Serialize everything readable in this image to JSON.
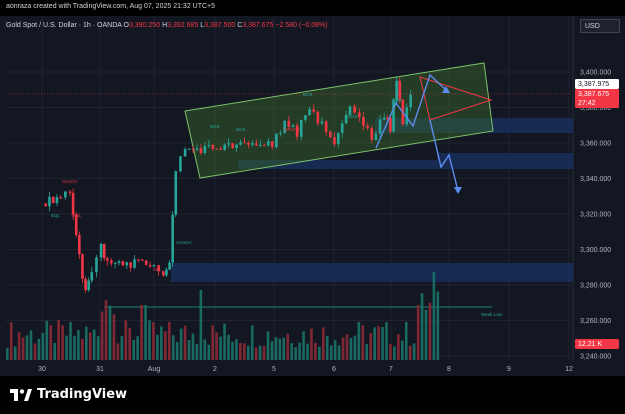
{
  "header": {
    "attribution": "aonraza created with TradingView.com, Aug 07, 2025 21:32 UTC+5"
  },
  "legend": {
    "symbol": "Gold Spot / U.S. Dollar · 1h · OANDA",
    "o_label": "O",
    "o_value": "3,390.250",
    "h_label": "H",
    "h_value": "3,392.685",
    "l_label": "L",
    "l_value": "3,387.500",
    "c_label": "C",
    "c_value": "3,387.675",
    "change": "−2.580 (−0.08%)"
  },
  "currency_button": "USD",
  "footer": {
    "brand": "TradingView",
    "logo_icon": "tradingview-logo-icon"
  },
  "colors": {
    "background": "#131722",
    "up": "#26a69a",
    "down": "#f23645",
    "channel": "#4caf50",
    "zone": "#1e3a6e",
    "arrow": "#2962ff",
    "triangle": "#f23645"
  },
  "chart_data": {
    "type": "candlestick",
    "symbol": "XAUUSD",
    "timeframe": "1h",
    "x_tick_labels": [
      "30",
      "31",
      "Aug",
      "2",
      "5",
      "6",
      "7",
      "8",
      "9",
      "12"
    ],
    "y_tick_labels": [
      "3,400.000",
      "3,380.000",
      "3,360.000",
      "3,340.000",
      "3,320.000",
      "3,300.000",
      "3,280.000",
      "3,260.000",
      "3,240.000"
    ],
    "ylim": [
      3240,
      3410
    ],
    "grid": true,
    "price_labels": {
      "ask": "3,387.975",
      "last": "3,387.675",
      "countdown": "27:42",
      "volume": "12.21 K"
    },
    "chart_annotations": [
      "CHoCH",
      "BOS",
      "BOS",
      "CHoCH",
      "BOS",
      "BOS",
      "Weak Low",
      "EQL",
      "BSL",
      "SSL",
      "CHoCH",
      "BOS"
    ],
    "price_series": [
      {
        "x": "Jul 30 00:00",
        "close": 3326
      },
      {
        "x": "Jul 30 12:00",
        "close": 3330
      },
      {
        "x": "Jul 30 18:00",
        "close": 3333
      },
      {
        "x": "Jul 30 20:00",
        "close": 3318
      },
      {
        "x": "Jul 31 00:00",
        "close": 3296
      },
      {
        "x": "Jul 31 04:00",
        "close": 3276
      },
      {
        "x": "Jul 31 08:00",
        "close": 3285
      },
      {
        "x": "Jul 31 14:00",
        "close": 3302
      },
      {
        "x": "Jul 31 18:00",
        "close": 3292
      },
      {
        "x": "Aug 1 00:00",
        "close": 3292
      },
      {
        "x": "Aug 1 06:00",
        "close": 3286
      },
      {
        "x": "Aug 1 10:00",
        "close": 3292
      },
      {
        "x": "Aug 1 14:00",
        "close": 3345
      },
      {
        "x": "Aug 1 20:00",
        "close": 3356
      },
      {
        "x": "Aug 4 04:00",
        "close": 3360
      },
      {
        "x": "Aug 4 12:00",
        "close": 3372
      },
      {
        "x": "Aug 4 20:00",
        "close": 3366
      },
      {
        "x": "Aug 5 04:00",
        "close": 3380
      },
      {
        "x": "Aug 5 12:00",
        "close": 3370
      },
      {
        "x": "Aug 5 20:00",
        "close": 3357
      },
      {
        "x": "Aug 6 06:00",
        "close": 3382
      },
      {
        "x": "Aug 6 12:00",
        "close": 3377
      },
      {
        "x": "Aug 6 20:00",
        "close": 3362
      },
      {
        "x": "Aug 7 04:00",
        "close": 3376
      },
      {
        "x": "Aug 7 08:00",
        "close": 3368
      },
      {
        "x": "Aug 7 12:00",
        "close": 3396
      },
      {
        "x": "Aug 7 16:00",
        "close": 3372
      },
      {
        "x": "Aug 7 21:00",
        "close": 3388
      }
    ]
  }
}
